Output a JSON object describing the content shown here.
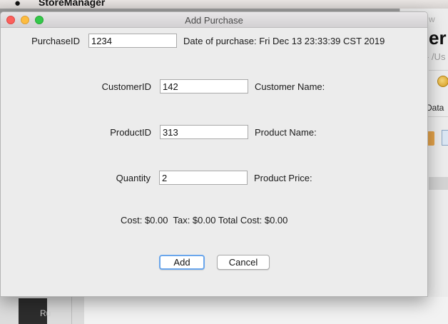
{
  "menubar": {
    "app_name": "StoreManager"
  },
  "background_window": {
    "title_partial": "w",
    "heading_partial": "er",
    "path_partial": "- /Us",
    "tab_partial": "Data",
    "sidebar_text_partial": "Ru"
  },
  "dialog": {
    "title": "Add Purchase",
    "purchase_id": {
      "label": "PurchaseID",
      "value": "1234"
    },
    "date_of_purchase": "Date of purchase: Fri Dec 13 23:33:39 CST 2019",
    "customer_id": {
      "label": "CustomerID",
      "value": "142"
    },
    "customer_name_label": "Customer Name:",
    "product_id": {
      "label": "ProductID",
      "value": "313"
    },
    "product_name_label": "Product Name:",
    "quantity": {
      "label": "Quantity",
      "value": "2"
    },
    "product_price_label": "Product Price:",
    "cost_summary": "Cost: $0.00  Tax: $0.00 Total Cost: $0.00",
    "buttons": {
      "add": "Add",
      "cancel": "Cancel"
    }
  },
  "colors": {
    "close": "#fc605c",
    "minimize": "#fdbc40",
    "zoom": "#34c84a",
    "default_button_focus": "#6aa6ec",
    "dialog_bg": "#ececec"
  }
}
